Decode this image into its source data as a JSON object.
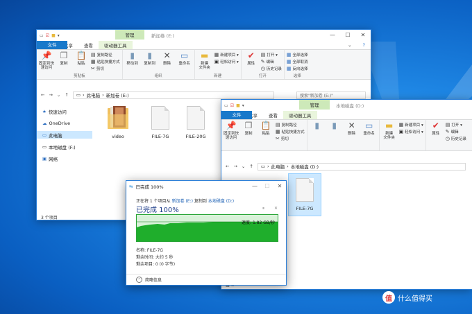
{
  "back_window": {
    "title": "新加卷 (E:)",
    "context_tab": "管理",
    "tabs": [
      "文件",
      "主页",
      "共享",
      "查看",
      "驱动器工具"
    ],
    "ribbon": {
      "clipboard": {
        "group_label": "剪贴板",
        "pin": "固定到快速访问",
        "copy": "复制",
        "paste": "粘贴",
        "copy_path": "复制路径",
        "paste_shortcut": "粘贴快捷方式",
        "cut": "剪切"
      },
      "organize": {
        "group_label": "组织",
        "move_to": "移动到",
        "copy_to": "复制到",
        "delete": "删除",
        "rename": "重命名"
      },
      "new": {
        "group_label": "新建",
        "new_folder": "新建\n文件夹",
        "new_item": "新建项目 ▾",
        "easy_access": "轻松访问 ▾"
      },
      "open": {
        "group_label": "打开",
        "properties": "属性",
        "open": "打开 ▾",
        "edit": "编辑",
        "history": "历史记录"
      },
      "select": {
        "group_label": "选择",
        "select_all": "全部选择",
        "select_none": "全部取消",
        "invert": "反向选择"
      }
    },
    "breadcrumb": [
      "此电脑",
      "新加卷 (E:)"
    ],
    "search_placeholder": "搜索\"新加卷 (E:)\"",
    "nav": [
      "快速访问",
      "OneDrive",
      "此电脑",
      "本地磁盘 (F:)",
      "网络"
    ],
    "files": [
      "video",
      "FILE-7G",
      "FILE-20G"
    ],
    "status": "3 个项目"
  },
  "front_window": {
    "title": "本地磁盘 (D:)",
    "context_tab": "管理",
    "tabs": [
      "文件",
      "主页",
      "共享",
      "查看",
      "驱动器工具"
    ],
    "ribbon": {
      "pin": "固定到快速访问",
      "copy": "复制",
      "paste": "粘贴",
      "copy_path": "复制路径",
      "paste_shortcut": "粘贴快捷方式",
      "cut": "剪切",
      "delete": "删除",
      "rename": "重命名",
      "new_folder": "新建\n文件夹",
      "new_item": "新建项目 ▾",
      "easy_access": "轻松访问 ▾",
      "properties": "属性",
      "open": "打开 ▾",
      "edit": "编辑",
      "history": "历史记录"
    },
    "breadcrumb": [
      "此电脑",
      "本地磁盘 (D:)"
    ],
    "files": [
      "FILE-7G"
    ]
  },
  "copy_dialog": {
    "title": "已完成 100%",
    "line_prefix": "正在将 1 个项目从",
    "source": "新加卷 (E:)",
    "mid": "复制到",
    "dest": "本地磁盘 (D:)",
    "heading": "已完成 100%",
    "progress": 1.0,
    "speed": "速度: 1.82 GB/秒",
    "name": "名称: FILE-7G",
    "time_left": "剩余时间: 大约 5 秒",
    "items_left": "剩余项目: 0 (0 字节)",
    "less_details": "简略信息",
    "colors": {
      "fill": "#1fae2c",
      "bg": "#d9f2d9",
      "link": "#1a5fb4"
    }
  },
  "watermark": {
    "badge": "值",
    "text": "什么值得买"
  }
}
